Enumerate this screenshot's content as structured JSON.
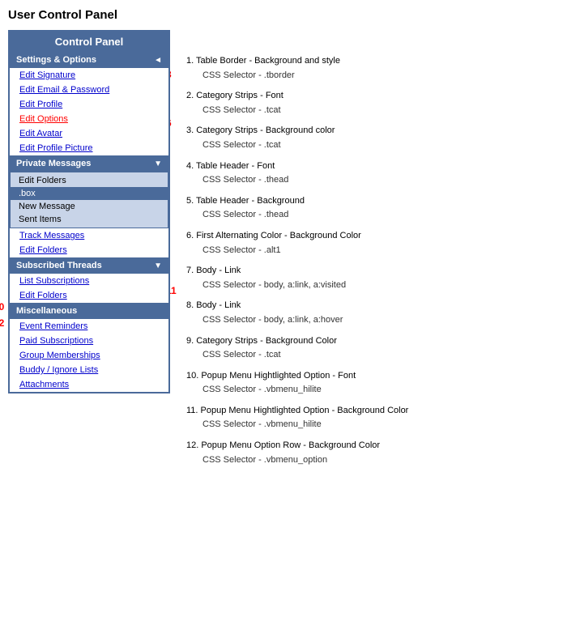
{
  "pageTitle": "User Control Panel",
  "leftPanel": {
    "header": "Control Panel",
    "sections": [
      {
        "type": "section-header",
        "label": "Settings & Options",
        "hasArrow": false
      },
      {
        "type": "link",
        "label": "Edit Signature"
      },
      {
        "type": "link",
        "label": "Edit Email & Password"
      },
      {
        "type": "link",
        "label": "Edit Profile"
      },
      {
        "type": "link",
        "label": "Edit Options"
      },
      {
        "type": "link",
        "label": "Edit Avatar"
      },
      {
        "type": "link",
        "label": "Edit Profile Picture"
      },
      {
        "type": "section-header",
        "label": "Private Messages",
        "hasArrow": true
      },
      {
        "type": "dropdown",
        "items": [
          {
            "label": "Edit Folders",
            "style": "normal"
          },
          {
            "label": ".box",
            "style": "highlighted"
          },
          {
            "label": "New Message",
            "style": "normal"
          },
          {
            "label": "Sent Items",
            "style": "normal"
          }
        ]
      },
      {
        "type": "link",
        "label": "Track Messages"
      },
      {
        "type": "link",
        "label": "Edit Folders"
      },
      {
        "type": "section-header",
        "label": "Subscribed Threads",
        "hasArrow": true
      },
      {
        "type": "link",
        "label": "List Subscriptions"
      },
      {
        "type": "link",
        "label": "Edit Folders"
      },
      {
        "type": "section-header",
        "label": "Miscellaneous",
        "hasArrow": false
      },
      {
        "type": "link",
        "label": "Event Reminders"
      },
      {
        "type": "link",
        "label": "Paid Subscriptions"
      },
      {
        "type": "link",
        "label": "Group Memberships"
      },
      {
        "type": "link",
        "label": "Buddy / Ignore Lists"
      },
      {
        "type": "link",
        "label": "Attachments"
      }
    ]
  },
  "annotations": [
    {
      "num": "1",
      "line1": "1. Table Border - Background and style",
      "line2": "CSS Selector - .tborder"
    },
    {
      "num": "2",
      "line1": "2. Category Strips - Font",
      "line2": "CSS Selector - .tcat"
    },
    {
      "num": "3",
      "line1": "3. Category Strips - Background color",
      "line2": "CSS Selector - .tcat"
    },
    {
      "num": "4",
      "line1": "4. Table Header - Font",
      "line2": "CSS Selector - .thead"
    },
    {
      "num": "5",
      "line1": "5. Table Header - Background",
      "line2": "CSS Selector - .thead"
    },
    {
      "num": "6",
      "line1": "6. First Alternating Color - Background Color",
      "line2": "CSS Selector - .alt1"
    },
    {
      "num": "7",
      "line1": "7. Body - Link",
      "line2": "CSS Selector - body, a:link, a:visited"
    },
    {
      "num": "8",
      "line1": "8. Body - Link",
      "line2": "CSS Selector - body, a:link, a:hover"
    },
    {
      "num": "9",
      "line1": "9. Category Strips - Background Color",
      "line2": "CSS Selector - .tcat"
    },
    {
      "num": "10",
      "line1": "10. Popup Menu Hightlighted Option - Font",
      "line2": "CSS Selector -  .vbmenu_hilite"
    },
    {
      "num": "11",
      "line1": "11. Popup Menu Hightlighted Option - Background Color",
      "line2": "CSS Selector - .vbmenu_hilite"
    },
    {
      "num": "12",
      "line1": "12. Popup Menu Option Row - Background Color",
      "line2": "CSS Selector - .vbmenu_option"
    }
  ]
}
